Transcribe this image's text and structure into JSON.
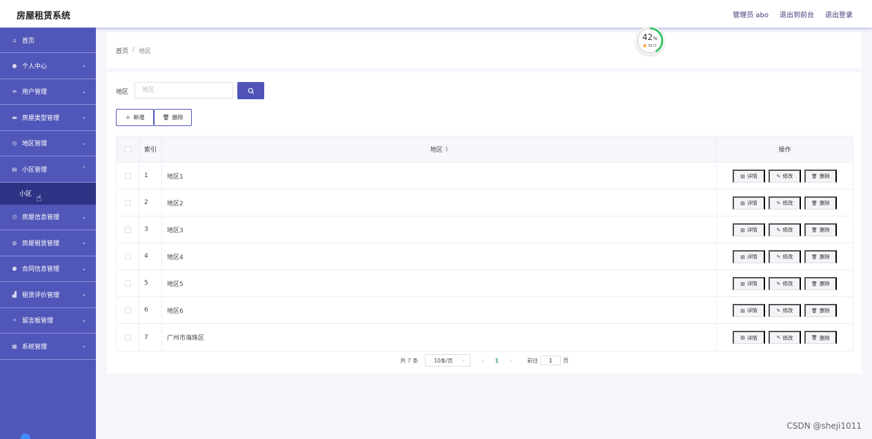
{
  "app": {
    "title": "房屋租赁系统"
  },
  "header": {
    "admin_label": "管理员 abo",
    "back_front": "退出到前台",
    "logout": "退出登录"
  },
  "sidebar": {
    "items": [
      {
        "label": "首页",
        "icon": "home-icon",
        "has_chevron": false
      },
      {
        "label": "个人中心",
        "icon": "user-icon",
        "has_chevron": true
      },
      {
        "label": "用户管理",
        "icon": "list-icon",
        "has_chevron": true
      },
      {
        "label": "房屋类型管理",
        "icon": "message-icon",
        "has_chevron": true
      },
      {
        "label": "地区管理",
        "icon": "compass-icon",
        "has_chevron": true
      },
      {
        "label": "小区管理",
        "icon": "briefcase-icon",
        "has_chevron": true,
        "expanded": true
      }
    ],
    "sub_item": "小区",
    "items_after": [
      {
        "label": "房屋信息管理",
        "icon": "clock-icon"
      },
      {
        "label": "房屋租赁管理",
        "icon": "globe-icon"
      },
      {
        "label": "合同信息管理",
        "icon": "person-icon"
      },
      {
        "label": "租赁评价管理",
        "icon": "thumb-icon"
      },
      {
        "label": "留言板管理",
        "icon": "crop-icon"
      },
      {
        "label": "系统管理",
        "icon": "grid-icon"
      }
    ]
  },
  "breadcrumb": {
    "home": "首页",
    "sep": "/",
    "current": "地区"
  },
  "gauge": {
    "percent": "42",
    "unit": "%",
    "temp": "51°C",
    "level": 0.42,
    "color": "#3cc36b"
  },
  "search": {
    "label": "地区",
    "placeholder": "地区"
  },
  "toolbar": {
    "add_label": "新增",
    "delete_label": "删除"
  },
  "table": {
    "headers": {
      "index": "索引",
      "name": "地区",
      "actions": "操作"
    },
    "rows": [
      {
        "index": "1",
        "name": "地区1"
      },
      {
        "index": "2",
        "name": "地区2"
      },
      {
        "index": "3",
        "name": "地区3"
      },
      {
        "index": "4",
        "name": "地区4"
      },
      {
        "index": "5",
        "name": "地区5"
      },
      {
        "index": "6",
        "name": "地区6"
      },
      {
        "index": "7",
        "name": "广州市海珠区"
      }
    ],
    "row_actions": {
      "detail": "详情",
      "edit": "修改",
      "delete": "删除"
    }
  },
  "pagination": {
    "total": "共 7 条",
    "page_size": "10条/页",
    "current_page": "1",
    "goto_prefix": "前往",
    "goto_value": "1",
    "goto_suffix": "页"
  },
  "watermark": "CSDN @sheji1011",
  "colors": {
    "sidebar": "#5157b8",
    "sidebar_active": "#2e3284",
    "primary": "#4f54b6"
  }
}
